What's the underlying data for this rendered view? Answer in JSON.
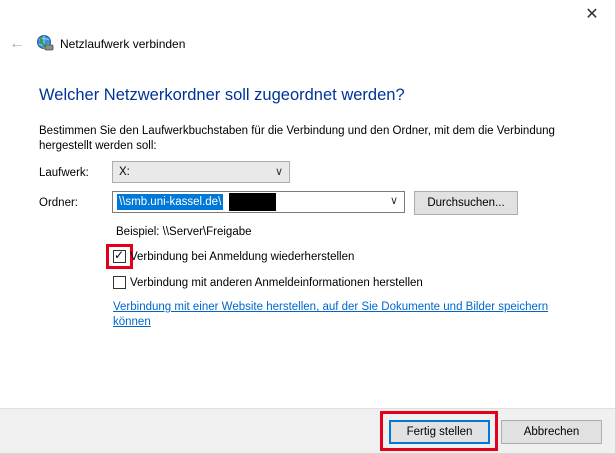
{
  "window": {
    "close_symbol": "✕",
    "back_symbol": "←",
    "title": "Netzlaufwerk verbinden",
    "title_icon": "network-drive-icon"
  },
  "main": {
    "heading": "Welcher Netzwerkordner soll zugeordnet werden?",
    "description": "Bestimmen Sie den Laufwerkbuchstaben für die Verbindung und den Ordner, mit dem die Verbindung hergestellt werden soll:",
    "drive": {
      "label": "Laufwerk:",
      "value": "X:"
    },
    "folder": {
      "label": "Ordner:",
      "value": "\\\\smb.uni-kassel.de\\"
    },
    "browse_button": "Durchsuchen...",
    "example": "Beispiel: \\\\Server\\Freigabe",
    "reconnect": {
      "label": "Verbindung bei Anmeldung wiederherstellen",
      "checked": true
    },
    "other_credentials": {
      "label": "Verbindung mit anderen Anmeldeinformationen herstellen",
      "checked": false
    },
    "website_link": "Verbindung mit einer Website herstellen, auf der Sie Dokumente und Bilder speichern können"
  },
  "footer": {
    "finish_button": "Fertig stellen",
    "cancel_button": "Abbrechen"
  },
  "colors": {
    "heading": "#003399",
    "link": "#0066cc",
    "selection": "#0078d7",
    "highlight": "#e3001b"
  }
}
